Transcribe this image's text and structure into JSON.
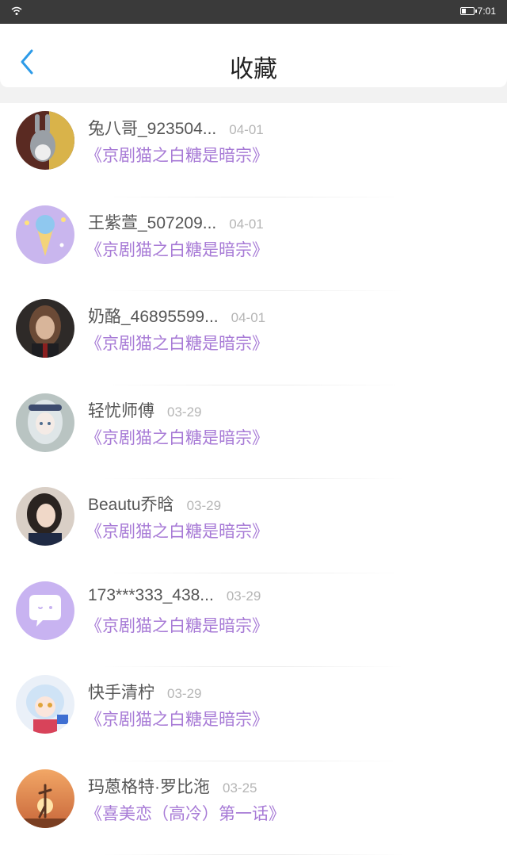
{
  "status_bar": {
    "time": "7:01"
  },
  "header": {
    "title": "收藏"
  },
  "colors": {
    "accent": "#2d9be8",
    "title_purple": "#a77ad6"
  },
  "items": [
    {
      "user": "兔八哥_923504...",
      "date": "04-01",
      "title": "《京剧猫之白糖是暗宗》",
      "avatar": "bugs-bunny-avatar"
    },
    {
      "user": "王紫萱_507209...",
      "date": "04-01",
      "title": "《京剧猫之白糖是暗宗》",
      "avatar": "ice-cream-avatar"
    },
    {
      "user": "奶酪_46895599...",
      "date": "04-01",
      "title": "《京剧猫之白糖是暗宗》",
      "avatar": "girl-portrait-avatar"
    },
    {
      "user": "轻忧师傅",
      "date": "03-29",
      "title": "《京剧猫之白糖是暗宗》",
      "avatar": "anime-girl-avatar"
    },
    {
      "user": "Beautu乔晗",
      "date": "03-29",
      "title": "《京剧猫之白糖是暗宗》",
      "avatar": "girl-photo-avatar"
    },
    {
      "user": "173***333_438...",
      "date": "03-29",
      "title": "《京剧猫之白糖是暗宗》",
      "avatar": "default-chat-avatar"
    },
    {
      "user": "快手清柠",
      "date": "03-29",
      "title": "《京剧猫之白糖是暗宗》",
      "avatar": "anime-character-avatar"
    },
    {
      "user": "玛蒽格特·罗比沲",
      "date": "03-25",
      "title": "《喜美恋（高冷）第一话》",
      "avatar": "sunset-dancer-avatar"
    }
  ]
}
